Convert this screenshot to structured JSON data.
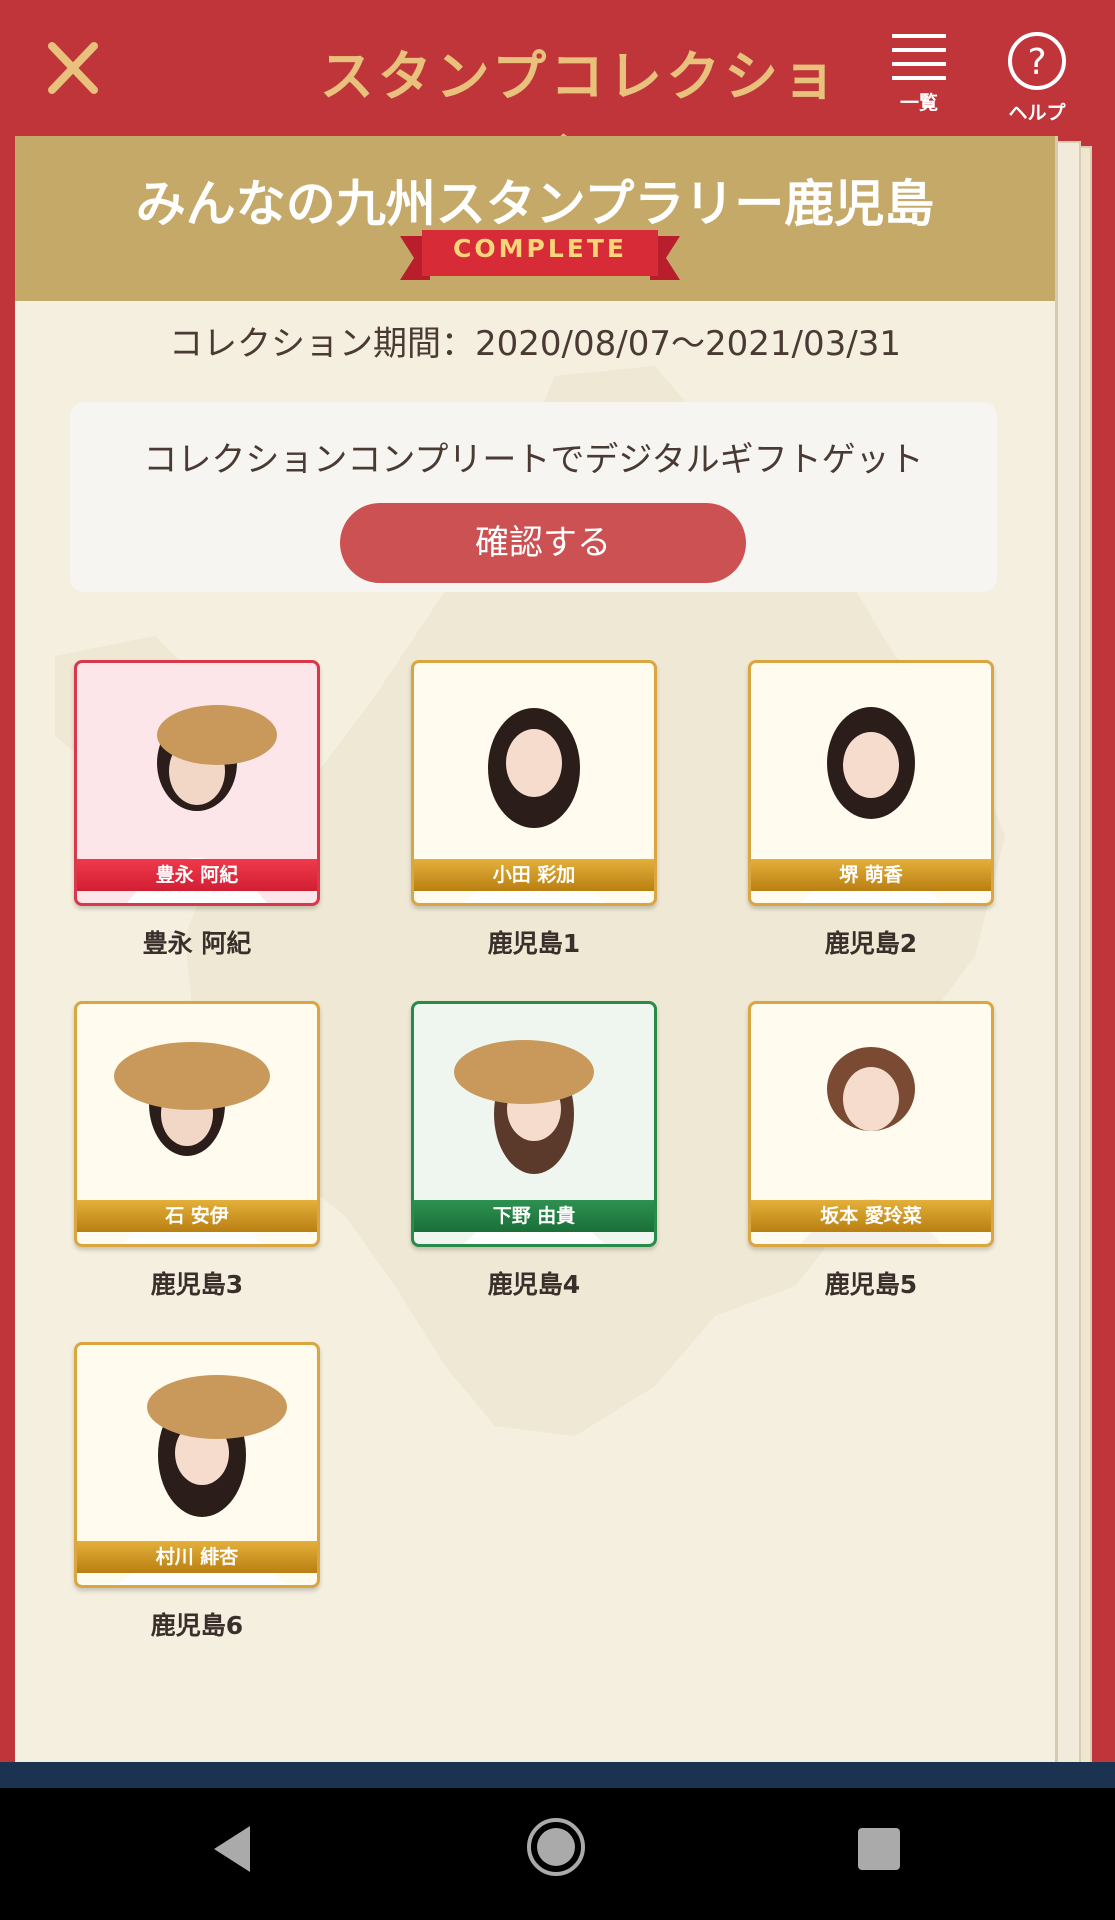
{
  "header": {
    "title": "スタンプコレクション",
    "list_label": "一覧",
    "help_label": "ヘルプ"
  },
  "collection": {
    "title": "みんなの九州スタンプラリー鹿児島",
    "badge": "COMPLETE",
    "period": "コレクション期間：2020/08/07〜2021/03/31"
  },
  "gift": {
    "text": "コレクションコンプリートでデジタルギフトゲット",
    "button_label": "確認する"
  },
  "stamps": [
    {
      "name": "豊永 阿紀",
      "caption": "豊永 阿紀",
      "style": "red"
    },
    {
      "name": "小田 彩加",
      "caption": "鹿児島1",
      "style": "gold"
    },
    {
      "name": "堺 萌香",
      "caption": "鹿児島2",
      "style": "gold"
    },
    {
      "name": "石 安伊",
      "caption": "鹿児島3",
      "style": "gold"
    },
    {
      "name": "下野 由貴",
      "caption": "鹿児島4",
      "style": "green"
    },
    {
      "name": "坂本 愛玲菜",
      "caption": "鹿児島5",
      "style": "gold"
    },
    {
      "name": "村川 緋杏",
      "caption": "鹿児島6",
      "style": "gold"
    }
  ],
  "colors": {
    "header_bg": "#c0353a",
    "title_gold": "#e8c27c",
    "banner_bg": "#c5a968",
    "button_red": "#cc5152"
  },
  "nav": {
    "back_icon": "back-triangle-icon",
    "home_icon": "home-circle-icon",
    "recent_icon": "recent-square-icon"
  }
}
